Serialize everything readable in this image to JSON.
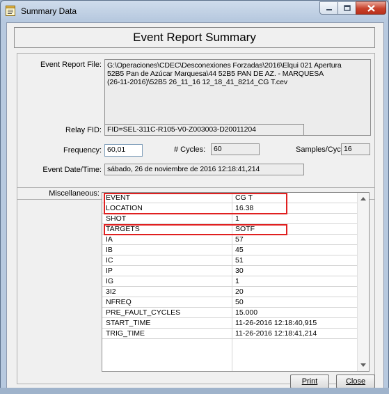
{
  "window": {
    "title": "Summary Data",
    "icons": {
      "app": "summary-document-icon",
      "minimize": "minimize-icon",
      "maximize": "maximize-icon",
      "close": "close-icon"
    },
    "colors": {
      "accent_close": "#c8412b",
      "highlight": "#e02020"
    }
  },
  "header": {
    "title": "Event Report Summary"
  },
  "event_report_file": {
    "label": "Event Report File:",
    "lines": [
      "G:\\Operaciones\\CDEC\\Desconexiones Forzadas\\2016\\Elqui 021 Apertura",
      "52B5 Pan de Azúcar Marquesa\\44 52B5 PAN DE AZ. - MARQUESA",
      "(26-11-2016)\\52B5  26_11_16 12_18_41_8214_CG T.cev"
    ]
  },
  "relay_fid": {
    "label": "Relay FID:",
    "value": "FID=SEL-311C-R105-V0-Z003003-D20011204"
  },
  "frequency": {
    "label": "Frequency:",
    "value": "60,01"
  },
  "cycles": {
    "label": "# Cycles:",
    "value": "60"
  },
  "samples_per_cycle": {
    "label": "Samples/Cycle:",
    "value": "16"
  },
  "event_datetime": {
    "label": "Event Date/Time:",
    "value": "sábado, 26 de noviembre de 2016  12:18:41,214"
  },
  "miscellaneous": {
    "label": "Miscellaneous:",
    "rows": [
      {
        "key": "EVENT",
        "value": "CG T",
        "highlighted": true
      },
      {
        "key": "LOCATION",
        "value": "16.38",
        "highlighted": true
      },
      {
        "key": "SHOT",
        "value": "1",
        "highlighted": false
      },
      {
        "key": "TARGETS",
        "value": "SOTF",
        "highlighted": true
      },
      {
        "key": "IA",
        "value": "57",
        "highlighted": false
      },
      {
        "key": "IB",
        "value": "45",
        "highlighted": false
      },
      {
        "key": "IC",
        "value": "51",
        "highlighted": false
      },
      {
        "key": "IP",
        "value": "30",
        "highlighted": false
      },
      {
        "key": "IG",
        "value": "1",
        "highlighted": false
      },
      {
        "key": "3I2",
        "value": "20",
        "highlighted": false
      },
      {
        "key": "NFREQ",
        "value": "50",
        "highlighted": false
      },
      {
        "key": "PRE_FAULT_CYCLES",
        "value": "15.000",
        "highlighted": false
      },
      {
        "key": "START_TIME",
        "value": "11-26-2016 12:18:40,915",
        "highlighted": false
      },
      {
        "key": "TRIG_TIME",
        "value": "11-26-2016 12:18:41,214",
        "highlighted": false
      }
    ]
  },
  "buttons": {
    "print": "Print",
    "close": "Close"
  }
}
